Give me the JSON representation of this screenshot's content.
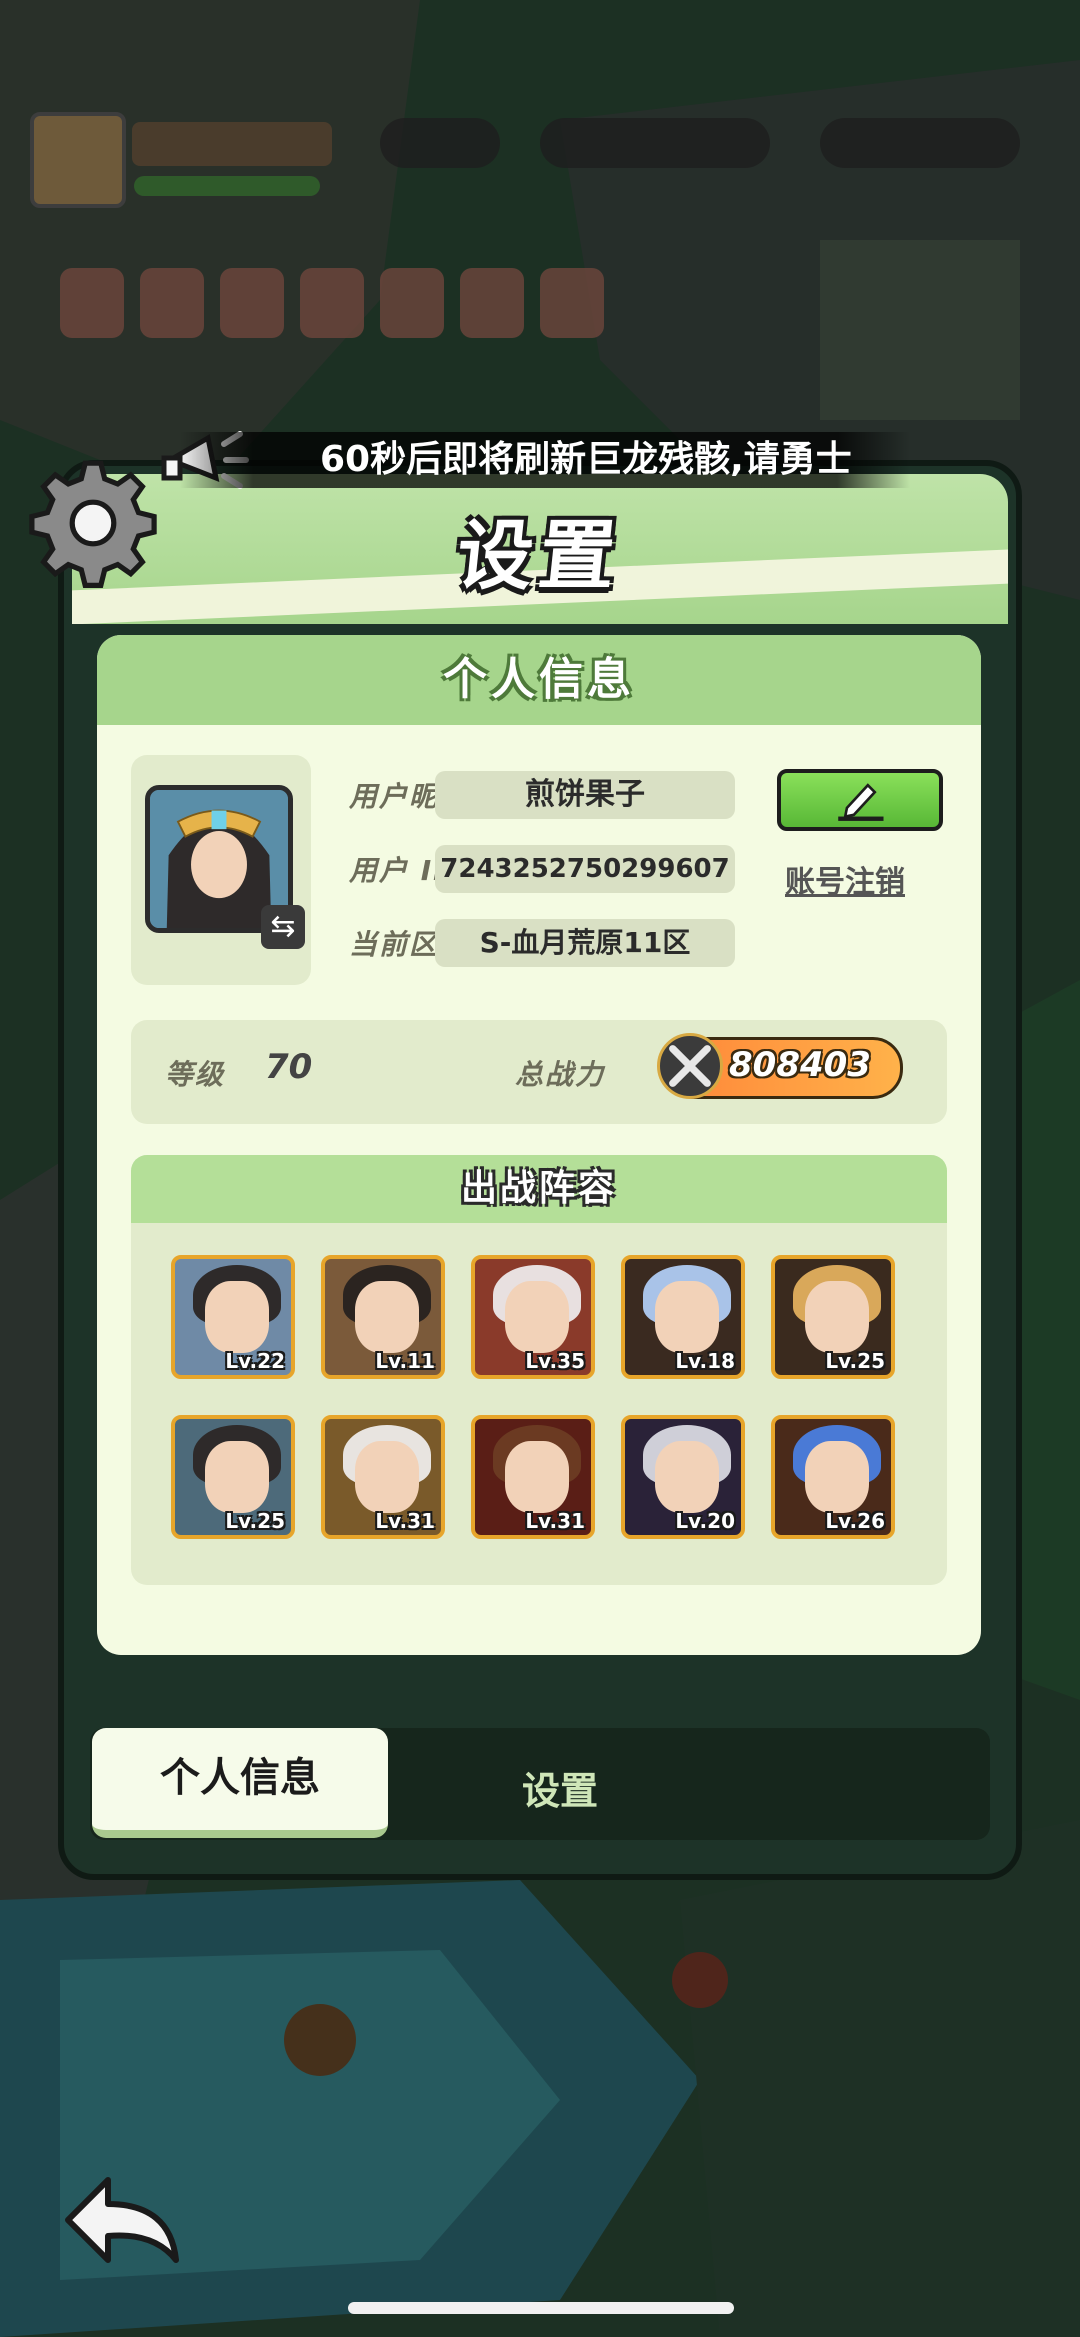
{
  "marquee": {
    "text": "60秒后即将刷新巨龙残骸,请勇士"
  },
  "panel": {
    "title": "设置"
  },
  "info": {
    "section_title": "个人信息",
    "nickname_label": "用户昵称",
    "nickname_value": "煎饼果子",
    "id_label": "用户 ID",
    "id_value": "7243252750299607",
    "logout_label": "账号注销",
    "server_label": "当前区服",
    "server_value": "S-血月荒原11区",
    "level_label": "等级",
    "level_value": "70",
    "power_label": "总战力",
    "power_value": "808403"
  },
  "team": {
    "title": "出战阵容",
    "heroes": [
      {
        "level": "Lv.22",
        "hair": "#2e2a2a",
        "bg": "#6f8aa6"
      },
      {
        "level": "Lv.11",
        "hair": "#2b2420",
        "bg": "#7b5a3a"
      },
      {
        "level": "Lv.35",
        "hair": "#e8e0e0",
        "bg": "#8a3a2a"
      },
      {
        "level": "Lv.18",
        "hair": "#a9c3e8",
        "bg": "#3a2a20"
      },
      {
        "level": "Lv.25",
        "hair": "#d9a85a",
        "bg": "#3a2a1e"
      },
      {
        "level": "Lv.25",
        "hair": "#2e2a2a",
        "bg": "#4d6a7a"
      },
      {
        "level": "Lv.31",
        "hair": "#e8e4e0",
        "bg": "#7a5a2a"
      },
      {
        "level": "Lv.31",
        "hair": "#6b3a22",
        "bg": "#5a1e16"
      },
      {
        "level": "Lv.20",
        "hair": "#cfcfd8",
        "bg": "#2a2238"
      },
      {
        "level": "Lv.26",
        "hair": "#4a7ad6",
        "bg": "#4a2a1a"
      }
    ]
  },
  "tabs": {
    "active": "个人信息",
    "inactive": "设置"
  },
  "colors": {
    "accent": "#a6d58c",
    "card": "#f4fbe2",
    "frame": "#e7a52a"
  }
}
